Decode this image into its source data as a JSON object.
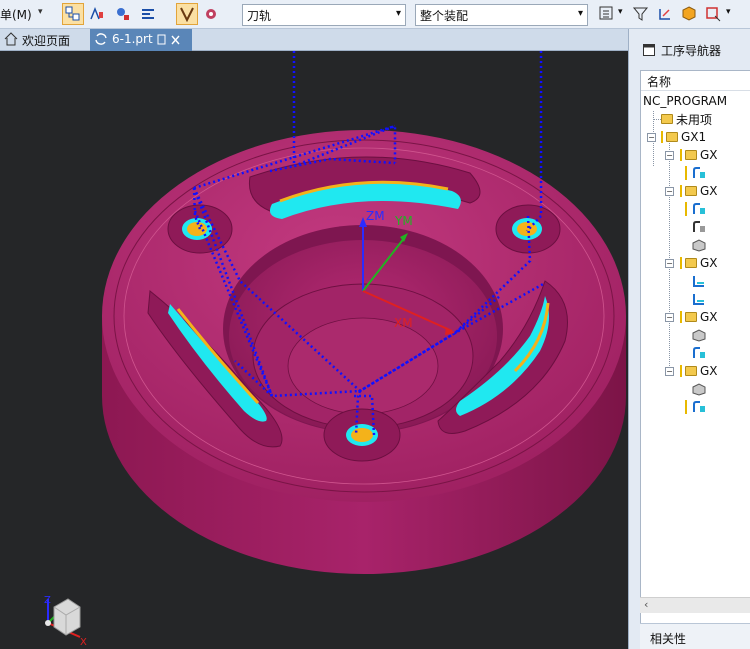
{
  "toolbar": {
    "menu_label": "单(M)",
    "combo_view": "刀轨",
    "combo_scope": "整个装配"
  },
  "tabs": [
    {
      "label": "欢迎页面"
    },
    {
      "label": "6-1.prt"
    }
  ],
  "navigator": {
    "title": "工序导航器",
    "column_header": "名称",
    "root": "NC_PROGRAM",
    "unused": "未用项",
    "group": "GX1",
    "subgroups": [
      "GX",
      "GX",
      "GX",
      "GX",
      "GX"
    ],
    "footer": "相关性"
  },
  "viewport": {
    "axis_labels": {
      "zm": "ZM",
      "ym": "YM",
      "xm": "XM",
      "triad_z": "Z",
      "triad_x": "X"
    }
  },
  "colors": {
    "part": "#b3266f",
    "toolpath": "#1010ff",
    "cut_cyan": "#20e8f0",
    "cut_yellow": "#f4b21a",
    "viewport_bg": "#252628"
  }
}
